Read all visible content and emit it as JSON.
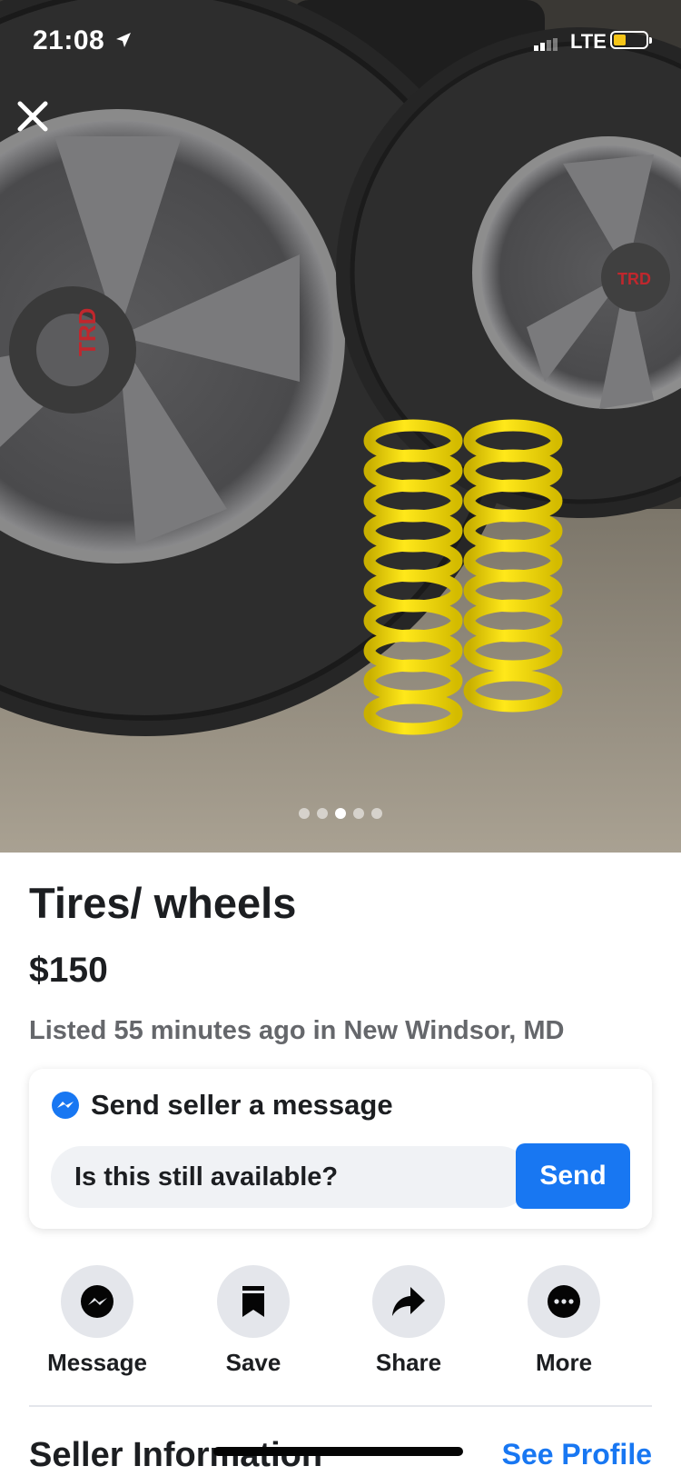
{
  "status_bar": {
    "time": "21:08",
    "network": "LTE",
    "battery_color": "#f5c518"
  },
  "photo": {
    "description_icon": "listing-photo",
    "carousel_count": 5,
    "carousel_active_index": 2
  },
  "listing": {
    "title": "Tires/ wheels",
    "price": "$150",
    "listed": "Listed 55 minutes ago in New Windsor, MD"
  },
  "message_card": {
    "heading": "Send seller a message",
    "input_value": "Is this still available?",
    "send_label": "Send",
    "accent_color": "#1877f2"
  },
  "actions": [
    {
      "label": "Message",
      "icon": "messenger-icon"
    },
    {
      "label": "Save",
      "icon": "bookmark-icon"
    },
    {
      "label": "Share",
      "icon": "share-icon"
    },
    {
      "label": "More",
      "icon": "more-icon"
    }
  ],
  "seller": {
    "heading": "Seller Information",
    "see_profile": "See Profile"
  }
}
